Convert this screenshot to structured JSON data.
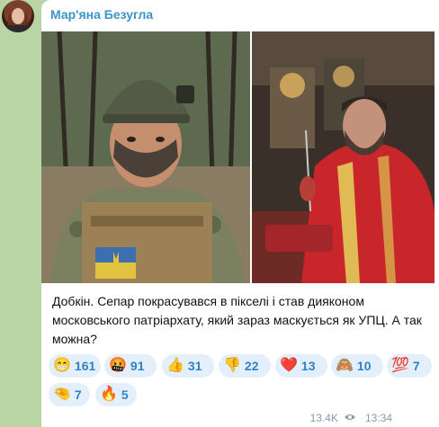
{
  "sender": {
    "name": "Мар'яна Безугла"
  },
  "message": {
    "text": "Добкін. Сепар покрасувався в пікселі і став дияконом московського патріархату, який зараз маскується як УПЦ. А так можна?",
    "views": "13.4K",
    "time": "13:34"
  },
  "reactions": [
    {
      "emoji": "😁",
      "icon": "grin-face-icon",
      "count": "161"
    },
    {
      "emoji": "🤬",
      "icon": "cursing-face-icon",
      "count": "91"
    },
    {
      "emoji": "👍",
      "icon": "thumbs-up-icon",
      "count": "31"
    },
    {
      "emoji": "👎",
      "icon": "thumbs-down-icon",
      "count": "22"
    },
    {
      "emoji": "❤️",
      "icon": "red-heart-icon",
      "count": "13"
    },
    {
      "emoji": "🙈",
      "icon": "see-no-evil-monkey-icon",
      "count": "10"
    },
    {
      "emoji": "💯",
      "icon": "hundred-points-icon",
      "count": "7"
    },
    {
      "emoji": "🤏",
      "icon": "pinching-hand-icon",
      "count": "7"
    },
    {
      "emoji": "🔥",
      "icon": "fire-icon",
      "count": "5"
    }
  ],
  "colors": {
    "background": "#b9d5a4",
    "sender": "#3a94c9",
    "reaction_bg": "#e3f0fb",
    "reaction_text": "#2f83c4"
  }
}
